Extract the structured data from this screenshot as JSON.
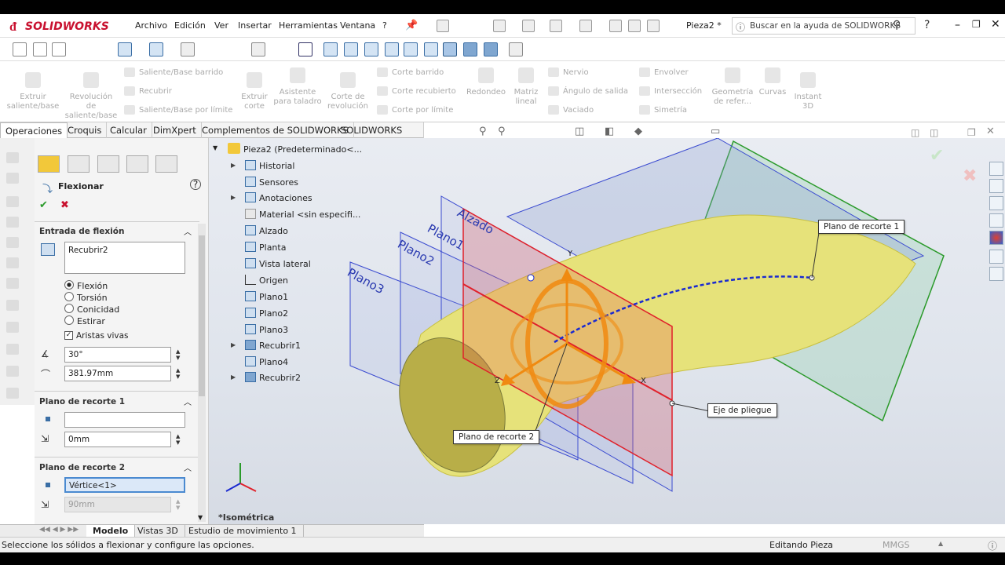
{
  "app": {
    "logo": "SOLIDWORKS",
    "doc_title": "Pieza2 *"
  },
  "menu": [
    "Archivo",
    "Edición",
    "Ver",
    "Insertar",
    "Herramientas",
    "Ventana",
    "?"
  ],
  "search": {
    "placeholder": "Buscar en la ayuda de SOLIDWORKS"
  },
  "ribbon": {
    "extrude_boss": "Extruir saliente/base",
    "revolve_boss": "Revolución de saliente/base",
    "swept_boss": "Saliente/Base barrido",
    "loft": "Recubrir",
    "boundary_boss": "Saliente/Base por límite",
    "extrude_cut": "Extruir corte",
    "hole_wizard": "Asistente para taladro",
    "revolve_cut": "Corte de revolución",
    "swept_cut": "Corte barrido",
    "lofted_cut": "Corte recubierto",
    "boundary_cut": "Corte por límite",
    "fillet": "Redondeo",
    "linear_pattern": "Matriz lineal",
    "rib": "Nervio",
    "draft": "Ángulo de salida",
    "shell": "Vaciado",
    "wrap": "Envolver",
    "intersect": "Intersección",
    "mirror": "Simetría",
    "ref_geometry": "Geometría de refer...",
    "curves": "Curvas",
    "instant3d": "Instant 3D"
  },
  "tabs": [
    "Operaciones",
    "Croquis",
    "Calcular",
    "DimXpert",
    "Complementos de SOLIDWORKS",
    "SOLIDWORKS MBD"
  ],
  "pm": {
    "title": "Flexionar",
    "section_input": "Entrada de flexión",
    "body": "Recubrir2",
    "options": [
      "Flexión",
      "Torsión",
      "Conicidad",
      "Estirar"
    ],
    "selected_option": "Flexión",
    "sharp_edges": "Aristas vivas",
    "angle": "30°",
    "radius": "381.97mm",
    "trim1_title": "Plano de recorte 1",
    "trim1_ref": "",
    "trim1_offset": "0mm",
    "trim2_title": "Plano de recorte 2",
    "trim2_ref": "Vértice<1>",
    "trim2_offset": "90mm"
  },
  "tree": {
    "root": "Pieza2 (Predeterminado<...",
    "items": [
      "Historial",
      "Sensores",
      "Anotaciones",
      "Material <sin especifi...",
      "Alzado",
      "Planta",
      "Vista lateral",
      "Origen",
      "Plano1",
      "Plano2",
      "Plano3",
      "Recubrir1",
      "Plano4",
      "Recubrir2"
    ]
  },
  "viewport": {
    "plane_labels": [
      "Alzado",
      "Plano1",
      "Plano2",
      "Plano3"
    ],
    "callout_trim1": "Plano de recorte 1",
    "callout_trim2": "Plano de recorte 2",
    "callout_axis": "Eje de pliegue",
    "view_name": "*Isométrica",
    "axes": [
      "Y",
      "Z",
      "X"
    ]
  },
  "bottom_tabs": [
    "Modelo",
    "Vistas 3D",
    "Estudio de movimiento 1"
  ],
  "status": {
    "message": "Seleccione los sólidos a flexionar y configure las opciones.",
    "mode": "Editando Pieza",
    "units": "MMGS"
  },
  "colors": {
    "brand": "#c8102e",
    "plane_red": "#e0202a",
    "plane_green": "#2a9a2a",
    "body_yellow": "#e6e27a",
    "triad_orange": "#f08a10"
  }
}
